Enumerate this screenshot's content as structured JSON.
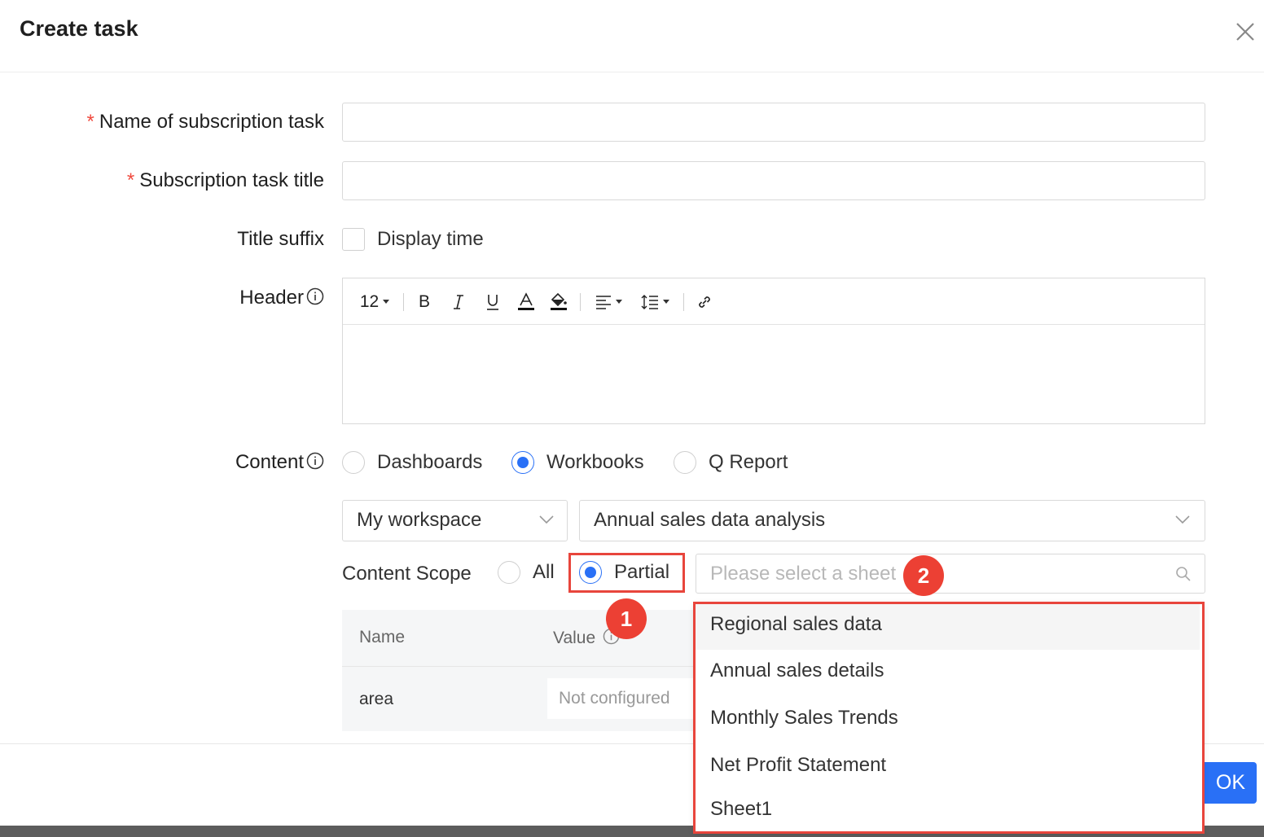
{
  "dialog": {
    "title": "Create task",
    "ok_label": "OK"
  },
  "form": {
    "name_label": "Name of subscription task",
    "title_label": "Subscription task title",
    "suffix_label": "Title suffix",
    "suffix_option": "Display time",
    "header_label": "Header",
    "content_label": "Content",
    "content_options": [
      "Dashboards",
      "Workbooks",
      "Q Report"
    ],
    "content_selected": "Workbooks",
    "workspace_value": "My workspace",
    "workbook_value": "Annual sales data analysis",
    "scope_label": "Content Scope",
    "scope_options": [
      "All",
      "Partial"
    ],
    "scope_selected": "Partial",
    "sheet_placeholder": "Please select a sheet"
  },
  "toolbar": {
    "font_size": "12",
    "bold": "B",
    "italic": "I",
    "underline": "U",
    "font_color": "A"
  },
  "param_table": {
    "headers": [
      "Name",
      "Value"
    ],
    "rows": [
      {
        "name": "area",
        "value": "Not configured"
      }
    ]
  },
  "sheet_dropdown": {
    "items": [
      "Regional sales data",
      "Annual sales details",
      "Monthly Sales Trends",
      "Net Profit Statement",
      "Sheet1"
    ],
    "hovered": "Regional sales data"
  },
  "annotations": {
    "badge1": "1",
    "badge2": "2"
  },
  "colors": {
    "accent": "#2970f6",
    "highlight": "#e8453c",
    "required": "#f04a3e"
  }
}
